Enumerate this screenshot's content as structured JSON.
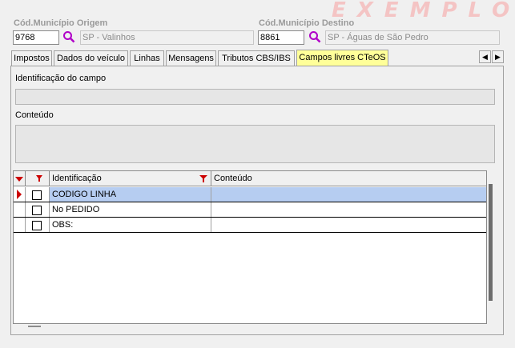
{
  "watermark": "EXEMPLO",
  "origem": {
    "label": "Cód.Município Origem",
    "code": "9768",
    "name": "SP - Valinhos"
  },
  "destino": {
    "label": "Cód.Município Destino",
    "code": "8861",
    "name": "SP - Águas de São Pedro"
  },
  "tabs": [
    {
      "label": "Impostos"
    },
    {
      "label": "Dados do veículo"
    },
    {
      "label": "Linhas"
    },
    {
      "label": "Mensagens"
    },
    {
      "label": "Tributos CBS/IBS"
    },
    {
      "label": "Campos livres CTeOS"
    }
  ],
  "active_tab": "Campos livres CTeOS",
  "form": {
    "ident_label": "Identificação do campo",
    "ident_value": "",
    "conteudo_label": "Conteúdo",
    "conteudo_value": ""
  },
  "grid": {
    "headers": {
      "ident": "Identificação",
      "conteudo": "Conteúdo"
    },
    "rows": [
      {
        "checked": false,
        "ident": "CODIGO LINHA",
        "conteudo": "",
        "selected": true
      },
      {
        "checked": false,
        "ident": "No PEDIDO",
        "conteudo": "",
        "selected": false
      },
      {
        "checked": false,
        "ident": "OBS:",
        "conteudo": "",
        "selected": false
      }
    ]
  },
  "colors": {
    "active_tab": "#ffff99",
    "selected_row": "#b6cdf1",
    "filter_icon": "#cc0000",
    "watermark": "#f4c4c4"
  }
}
